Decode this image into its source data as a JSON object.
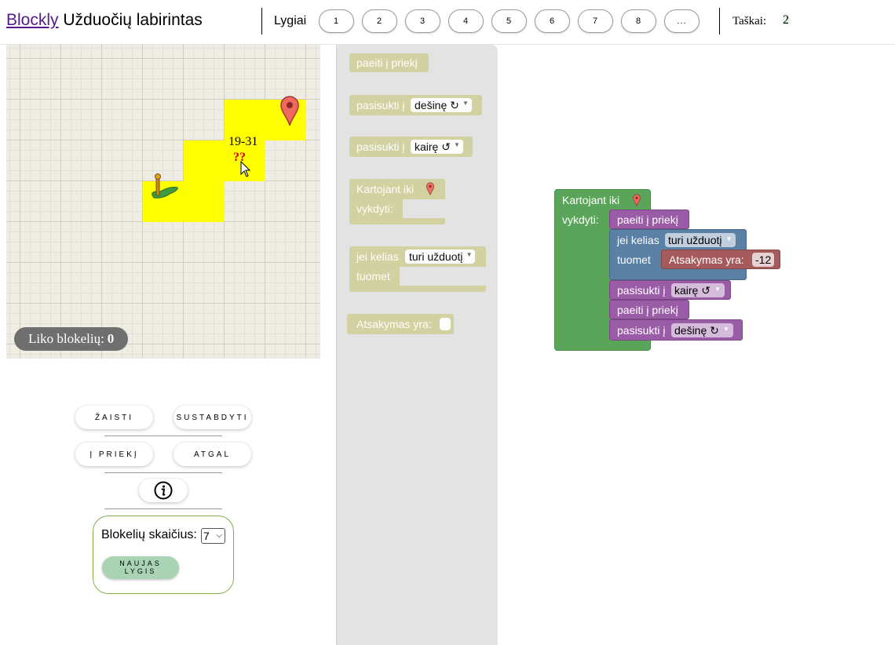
{
  "header": {
    "title_link": "Blockly",
    "title_rest": " Užduočių labirintas",
    "levels_label": "Lygiai",
    "levels": [
      "1",
      "2",
      "3",
      "4",
      "5",
      "6",
      "7",
      "8",
      "..."
    ],
    "points_label": "Taškai:",
    "points_value": "2"
  },
  "maze": {
    "task_text": "19-31",
    "task_question": "??",
    "remaining_label": "Liko blokelių: ",
    "remaining_value": "0",
    "path_color": "#ffff00"
  },
  "controls": {
    "play": "ŽAISTI",
    "stop": "SUSTABDYTI",
    "forward": "Į PRIEKĮ",
    "back": "ATGAL",
    "block_count_label": "Blokelių skaičius:",
    "block_count_value": "7",
    "new_level": "NAUJAS LYGIS"
  },
  "toolbox": {
    "move_forward": "paeiti į priekį",
    "turn_label": "pasisukti į",
    "turn_right": "dešinę ↻",
    "turn_left": "kairę ↺",
    "repeat_label": "Kartojant iki",
    "do_label": "vykdyti:",
    "if_label": "jei kelias",
    "if_option": "turi užduotį",
    "then_label": "tuomet",
    "answer_label": "Atsakymas yra:"
  },
  "workspace": {
    "repeat_label": "Kartojant iki",
    "do_label": "vykdyti:",
    "move_forward_1": "paeiti į priekį",
    "if_label": "jei kelias",
    "if_option": "turi užduotį",
    "then_label": "tuomet",
    "answer_label": "Atsakymas yra:",
    "answer_value": "-12",
    "turn_label_1": "pasisukti į",
    "turn_value_1": "kairę ↺",
    "move_forward_2": "paeiti į priekį",
    "turn_label_2": "pasisukti į",
    "turn_value_2": "dešinę ↻"
  },
  "colors": {
    "loop_block": "#5ba55b",
    "action_block": "#9a5ca6",
    "logic_block": "#5b80a5",
    "answer_block": "#a55b5b",
    "toolbox_block": "#d2d19e"
  }
}
